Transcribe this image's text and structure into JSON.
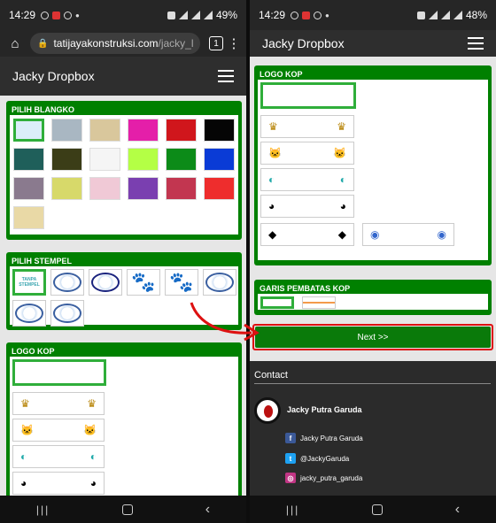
{
  "left": {
    "status": {
      "time": "14:29",
      "battery": "49%"
    },
    "url": {
      "host": "tatijayakonstruksi.com",
      "path": "/jacky_l",
      "tabs": "1"
    },
    "site_title": "Jacky Dropbox",
    "pilih_blangko": {
      "title": "PILIH BLANGKO"
    },
    "pilih_stempel": {
      "title": "PILIH STEMPEL",
      "text_stamp": "TANPA STEMPEL"
    },
    "logo_kop": {
      "title": "LOGO KOP"
    }
  },
  "right": {
    "status": {
      "time": "14:29",
      "battery": "48%"
    },
    "site_title": "Jacky Dropbox",
    "logo_kop": {
      "title": "LOGO KOP"
    },
    "garis": {
      "title": "GARIS PEMBATAS KOP"
    },
    "next_button": "Next >>",
    "contact": {
      "title": "Contact",
      "name": "Jacky Putra Garuda",
      "facebook": "Jacky Putra Garuda",
      "twitter": "@JackyGaruda",
      "instagram": "jacky_putra_garuda"
    }
  },
  "colors": {
    "panel_green": "#008000",
    "selected_border": "#2fae3a",
    "next_button": "#0a7a0a",
    "highlight_red": "#d11"
  },
  "swatch_colors": [
    "#dbeef9",
    "#a9b7c2",
    "#d9c79c",
    "#e41fa9",
    "#d0161c",
    "#050505",
    "#1f5f5a",
    "#3b3d17",
    "#f5f5f5",
    "#b4ff45",
    "#0c8b18",
    "#0a3bd6",
    "#8a7a8e",
    "#d7d96a",
    "#f0c9d6",
    "#7a3fb0",
    "#c23650",
    "#ee2d2d",
    "#e9d9a6"
  ]
}
